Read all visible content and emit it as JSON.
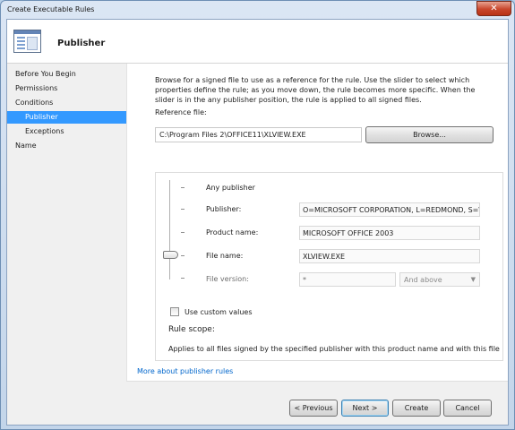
{
  "window": {
    "title": "Create Executable Rules",
    "close_label": "✕"
  },
  "header": {
    "title": "Publisher",
    "icon": "wizard-page-icon"
  },
  "steps": [
    {
      "label": "Before You Begin",
      "active": false,
      "sub": false
    },
    {
      "label": "Permissions",
      "active": false,
      "sub": false
    },
    {
      "label": "Conditions",
      "active": false,
      "sub": false
    },
    {
      "label": "Publisher",
      "active": true,
      "sub": true
    },
    {
      "label": "Exceptions",
      "active": false,
      "sub": true
    },
    {
      "label": "Name",
      "active": false,
      "sub": false
    }
  ],
  "main": {
    "intro": "Browse for a signed file to use as a reference for the rule. Use the slider to select which properties define the rule; as you move down, the rule becomes more specific. When the slider is in the any publisher position, the rule is applied to all signed files.",
    "reference_label": "Reference file:",
    "reference_value": "C:\\Program Files 2\\OFFICE11\\XLVIEW.EXE",
    "browse_label": "Browse...",
    "rows": {
      "any_publisher": "Any publisher",
      "publisher_label": "Publisher:",
      "publisher_value": "O=MICROSOFT CORPORATION, L=REDMOND, S=\\",
      "product_label": "Product name:",
      "product_value": "MICROSOFT OFFICE 2003",
      "file_label": "File name:",
      "file_value": "XLVIEW.EXE",
      "version_label": "File version:",
      "version_value": "*",
      "version_select": "And above"
    },
    "slider_level": "File name",
    "custom_values_label": "Use custom values",
    "custom_values_checked": false,
    "scope_label": "Rule scope:",
    "scope_text": "Applies to all files signed by the specified publisher with this product name and with this file",
    "more_link": "More about publisher rules"
  },
  "footer": {
    "previous": "< Previous",
    "next": "Next >",
    "create": "Create",
    "cancel": "Cancel"
  },
  "colors": {
    "selection": "#3399ff",
    "link": "#0066cc",
    "close": "#c8462c"
  }
}
